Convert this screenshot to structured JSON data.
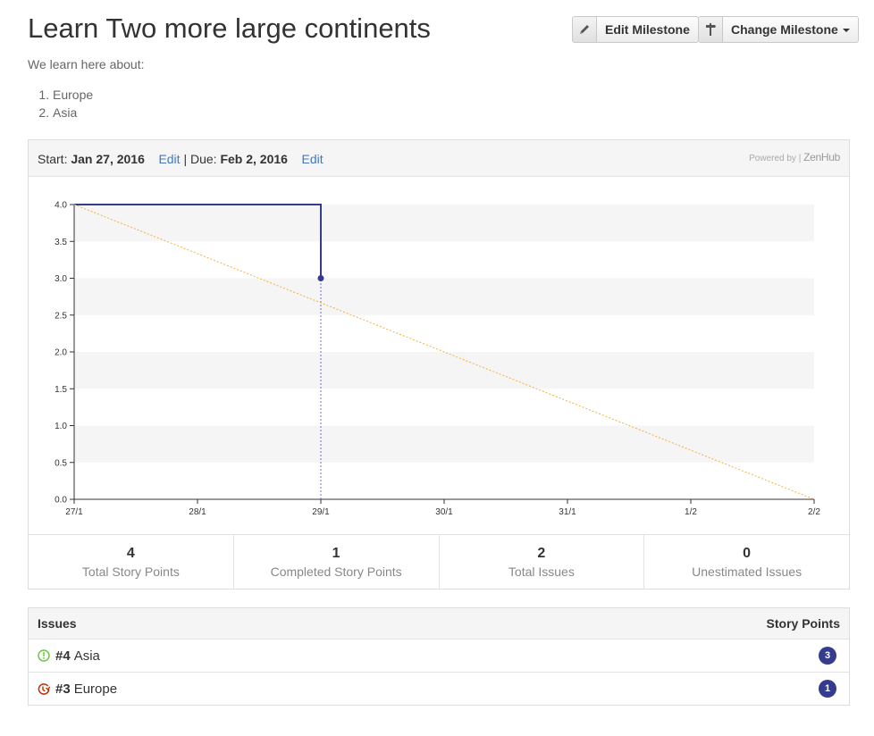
{
  "milestone": {
    "title": "Learn Two more large continents",
    "description": "We learn here about:",
    "items": [
      "Europe",
      "Asia"
    ]
  },
  "toolbar": {
    "edit_label": "Edit Milestone",
    "change_label": "Change Milestone",
    "edit_icon": "pencil-icon",
    "change_icon": "signpost-icon"
  },
  "dates": {
    "start_label": "Start:",
    "start_value": "Jan 27, 2016",
    "start_edit": "Edit",
    "separator": "|",
    "due_label": "Due:",
    "due_value": "Feb 2, 2016",
    "due_edit": "Edit"
  },
  "powered_by": {
    "prefix": "Powered by |",
    "brand": "ZenHub"
  },
  "chart_data": {
    "type": "line",
    "x": [
      "27/1",
      "28/1",
      "29/1",
      "30/1",
      "31/1",
      "1/2",
      "2/2"
    ],
    "ylim": [
      0,
      4
    ],
    "yticks": [
      "0.0",
      "0.5",
      "1.0",
      "1.5",
      "2.0",
      "2.5",
      "3.0",
      "3.5",
      "4.0"
    ],
    "series": [
      {
        "points": [
          [
            "27/1",
            4
          ],
          [
            "29/1",
            4
          ],
          [
            "29/1",
            3
          ]
        ],
        "color": "#353c8f"
      },
      {
        "points": [
          [
            "27/1",
            4
          ],
          [
            "2/2",
            0
          ]
        ],
        "color": "#f5b041",
        "style": "dotted"
      }
    ],
    "marker": {
      "x": "29/1",
      "y": 3
    },
    "today": "29/1",
    "band_color": "#f5f5f5"
  },
  "stats": [
    {
      "value": "4",
      "label": "Total Story Points"
    },
    {
      "value": "1",
      "label": "Completed Story Points"
    },
    {
      "value": "2",
      "label": "Total Issues"
    },
    {
      "value": "0",
      "label": "Unestimated Issues"
    }
  ],
  "issues": {
    "header_left": "Issues",
    "header_right": "Story Points",
    "rows": [
      {
        "number": "#4",
        "title": "Asia",
        "points": "3",
        "status_icon": "open-issue-icon",
        "status_color": "#6cc644"
      },
      {
        "number": "#3",
        "title": "Europe",
        "points": "1",
        "status_icon": "closed-issue-icon",
        "status_color": "#bd2c00"
      }
    ]
  }
}
